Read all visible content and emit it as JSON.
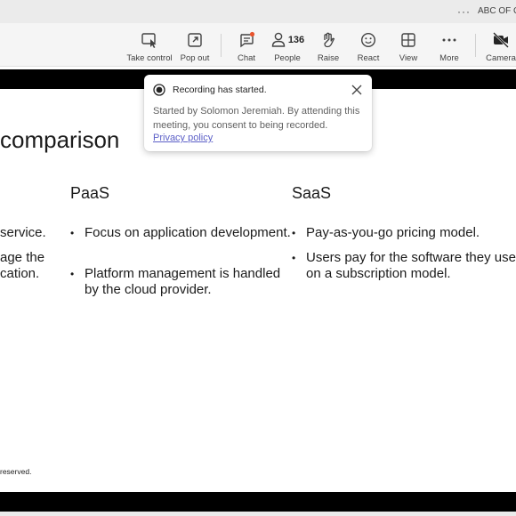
{
  "window": {
    "title": "ABC OF Cl",
    "more_label": "···"
  },
  "toolbar": {
    "take_control": {
      "label": "Take control",
      "icon": "take-control-icon"
    },
    "pop_out": {
      "label": "Pop out",
      "icon": "pop-out-icon"
    },
    "chat": {
      "label": "Chat",
      "icon": "chat-icon",
      "has_notification": true
    },
    "people": {
      "label": "People",
      "count": "136",
      "icon": "people-icon"
    },
    "raise": {
      "label": "Raise",
      "icon": "raise-hand-icon"
    },
    "react": {
      "label": "React",
      "icon": "react-icon"
    },
    "view": {
      "label": "View",
      "icon": "view-icon"
    },
    "more": {
      "label": "More",
      "icon": "more-icon"
    },
    "camera": {
      "label": "Camera",
      "icon": "camera-off-icon"
    }
  },
  "toast": {
    "heading": "Recording has started.",
    "body": "Started by Solomon Jeremiah. By attending this meeting, you consent to being recorded.",
    "link": "Privacy policy"
  },
  "slide": {
    "title": "comparison",
    "left_fragments": [
      "service.",
      "age the",
      "cation."
    ],
    "columns": [
      {
        "heading": "PaaS",
        "bullets": [
          "Focus on application development.",
          "Platform management is handled by the cloud provider."
        ]
      },
      {
        "heading": "SaaS",
        "bullets": [
          "Pay-as-you-go pricing model.",
          "Users pay for the software they use on a subscription model."
        ]
      }
    ],
    "footer": "reserved."
  },
  "colors": {
    "accent": "#5b5fc7",
    "notification": "#e8542d",
    "stage_bar": "#000000"
  }
}
